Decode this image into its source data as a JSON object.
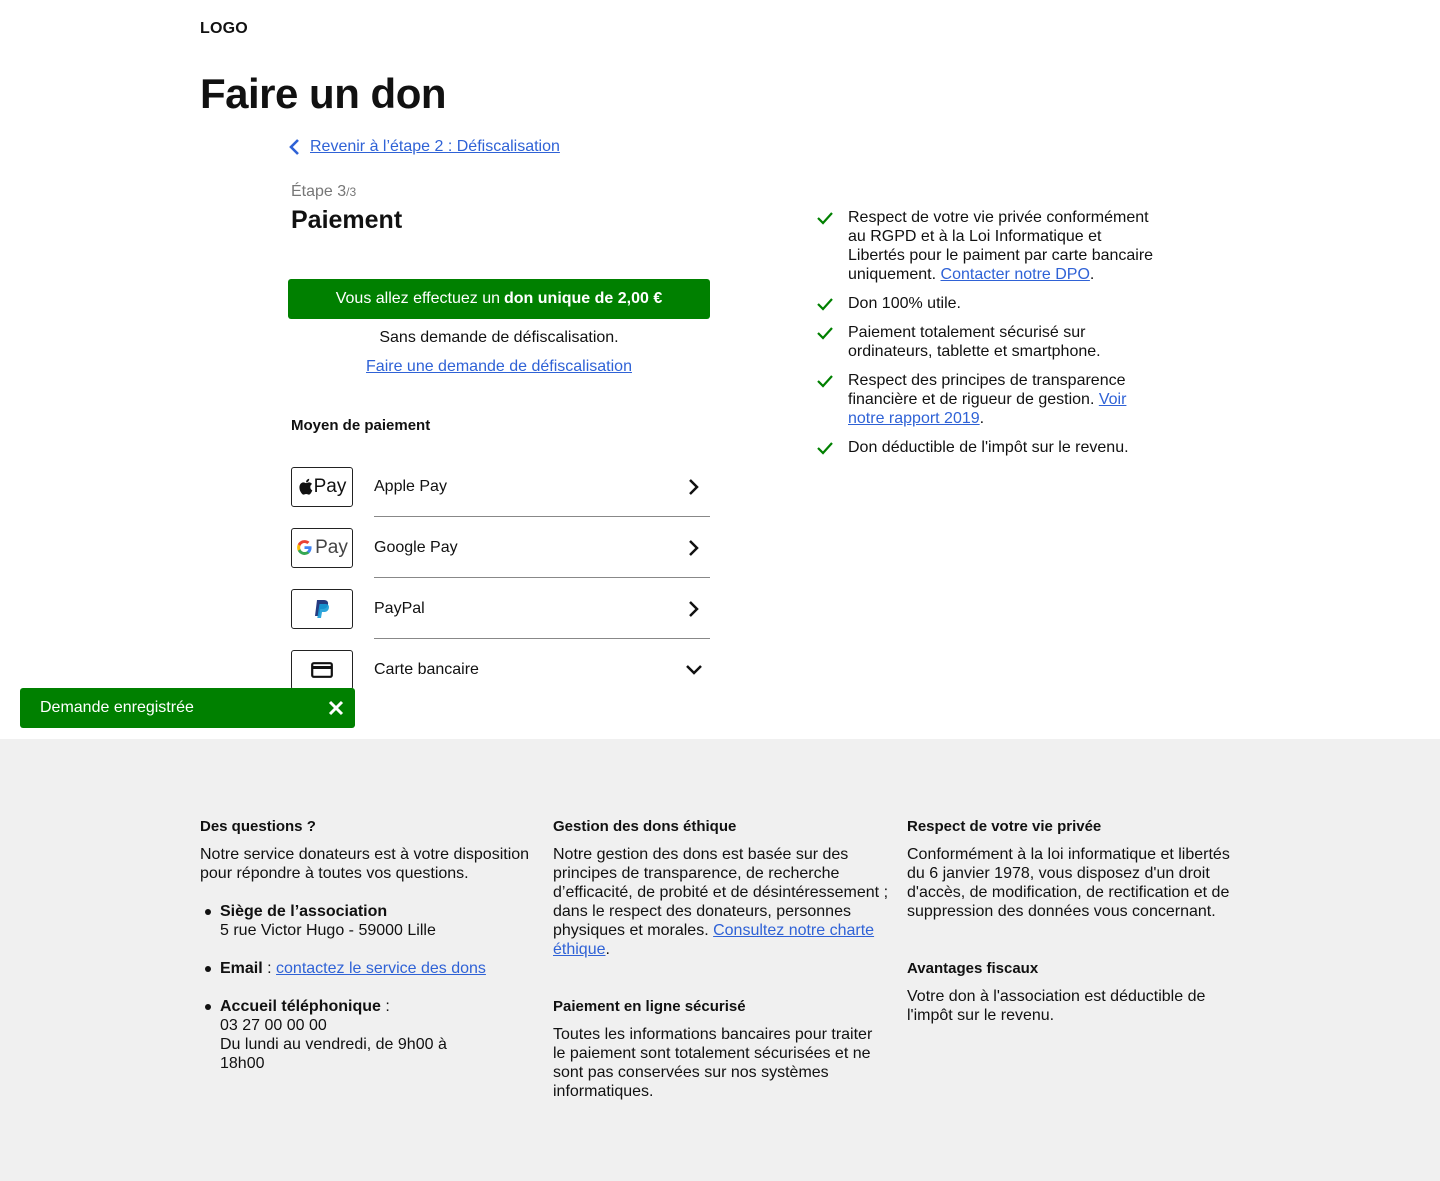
{
  "header": {
    "logo": "LOGO",
    "page_title": "Faire un don"
  },
  "nav": {
    "back_link": "Revenir à l’étape 2 : Défiscalisation"
  },
  "step": {
    "label": "Étape 3",
    "of": "/3",
    "title": "Paiement"
  },
  "summary": {
    "banner_prefix": "Vous allez effectuez un",
    "banner_bold": "don unique de 2,00 €",
    "no_tax_text": "Sans demande de défiscalisation.",
    "tax_request_link": "Faire une demande de défiscalisation"
  },
  "payment": {
    "section_title": "Moyen de paiement",
    "methods": [
      {
        "label": "Apple Pay",
        "icon": "apple-pay-logo",
        "action": "chevron-right"
      },
      {
        "label": "Google Pay",
        "icon": "google-pay-logo",
        "action": "chevron-right"
      },
      {
        "label": "PayPal",
        "icon": "paypal-logo",
        "action": "chevron-right"
      },
      {
        "label": "Carte bancaire",
        "icon": "credit-card-icon",
        "action": "chevron-down"
      }
    ],
    "apple_logo_text": "Pay",
    "google_logo_text": "Pay"
  },
  "toast": {
    "message": "Demande enregistrée"
  },
  "guarantees": [
    {
      "text": "Respect de votre vie privée conformément au RGPD et à la Loi Informatique et Libertés pour le paiment par carte bancaire uniquement.",
      "link": "Contacter notre DPO",
      "suffix": "."
    },
    {
      "text": "Don 100% utile.",
      "link": "",
      "suffix": ""
    },
    {
      "text": "Paiement totalement sécurisé sur ordinateurs, tablette et smartphone.",
      "link": "",
      "suffix": ""
    },
    {
      "text": "Respect des principes de transparence financière et de rigueur de gestion.",
      "link": "Voir notre rapport 2019",
      "suffix": "."
    },
    {
      "text": "Don déductible de l'impôt sur le revenu.",
      "link": "",
      "suffix": ""
    }
  ],
  "footer": {
    "questions": {
      "title": "Des questions ?",
      "intro": "Notre service donateurs est à votre disposition pour répondre à toutes vos questions.",
      "hq_label": "Siège de l’association",
      "hq_address": "5 rue Victor Hugo - 59000 Lille",
      "email_label": "Email",
      "email_sep": " : ",
      "email_link": "contactez le service des dons",
      "phone_label": "Accueil téléphonique",
      "phone_sep": " :",
      "phone_number": "03 27 00 00 00",
      "phone_hours": "Du lundi au vendredi, de 9h00 à 18h00"
    },
    "ethics": {
      "title": "Gestion des dons éthique",
      "text": "Notre gestion des dons est basée sur des principes de transparence, de recherche d’efficacité, de probité et de désintéressement ; dans le respect des donateurs, personnes physiques et morales.",
      "link": "Consultez notre charte éthique",
      "suffix": "."
    },
    "secure": {
      "title": "Paiement en ligne sécurisé",
      "text": "Toutes les informations bancaires pour traiter le paiement sont totalement sécurisées et ne sont pas conservées sur nos systèmes informatiques."
    },
    "privacy": {
      "title": "Respect de votre vie privée",
      "text": "Conformément à la loi informatique et libertés du 6 janvier 1978, vous disposez d'un droit d'accès, de modification, de rectification et de suppression des données vous concernant."
    },
    "tax": {
      "title": "Avantages fiscaux",
      "text": "Votre don à l'association est déductible de l'impôt sur le revenu."
    }
  },
  "colors": {
    "primary_green": "#008000",
    "link_blue": "#2f62d6",
    "footer_bg": "#f0f0f0"
  }
}
